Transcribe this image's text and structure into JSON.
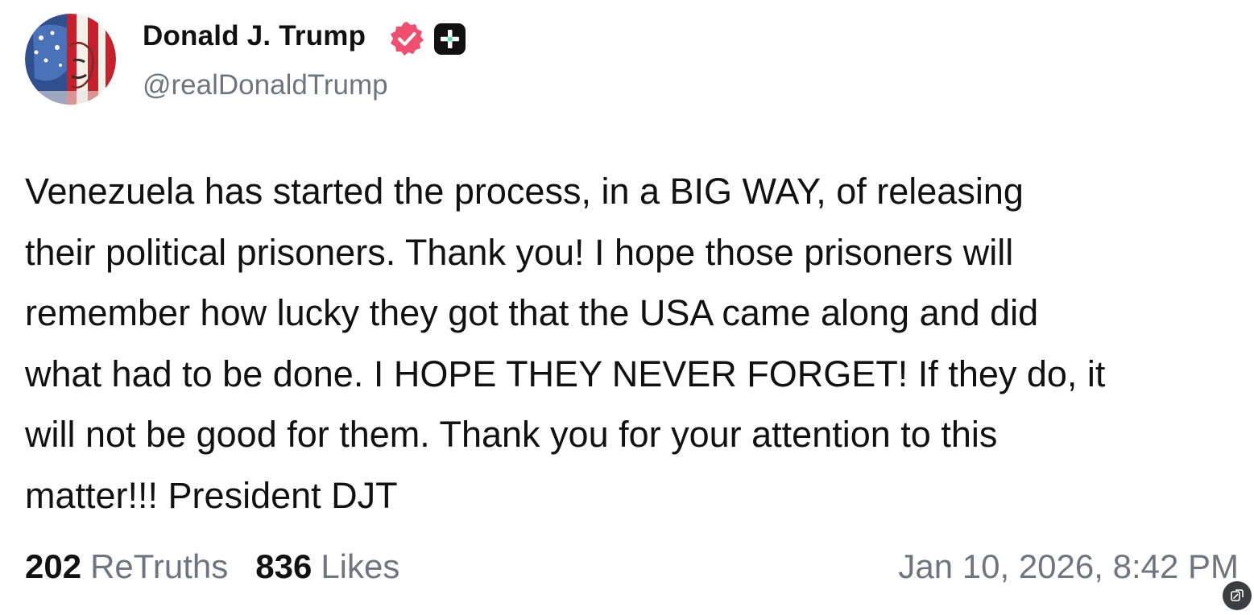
{
  "post": {
    "author": {
      "display_name": "Donald J. Trump",
      "handle": "@realDonaldTrump",
      "verified_icon": "verified-badge-icon",
      "plus_icon": "plus-square-icon"
    },
    "text": "Venezuela has started the process, in a BIG WAY, of releasing\ntheir political prisoners. Thank you! I hope those prisoners will\nremember how lucky they got that the USA came along and did\nwhat had to be done. I HOPE THEY NEVER FORGET! If they do, it\nwill not be good for them. Thank you for your attention to this\nmatter!!! President DJT",
    "stats": {
      "retruths_count": "202",
      "retruths_label": "ReTruths",
      "likes_count": "836",
      "likes_label": "Likes"
    },
    "timestamp": "Jan 10, 2026, 8:42 PM"
  },
  "corner_button_icon": "copy-edit-icon",
  "colors": {
    "verified_badge": "#ee4f6f",
    "muted_text": "#6e7480",
    "primary_text": "#111111",
    "plus_badge": "#111111",
    "plus_accent": "#5ce0b0"
  }
}
